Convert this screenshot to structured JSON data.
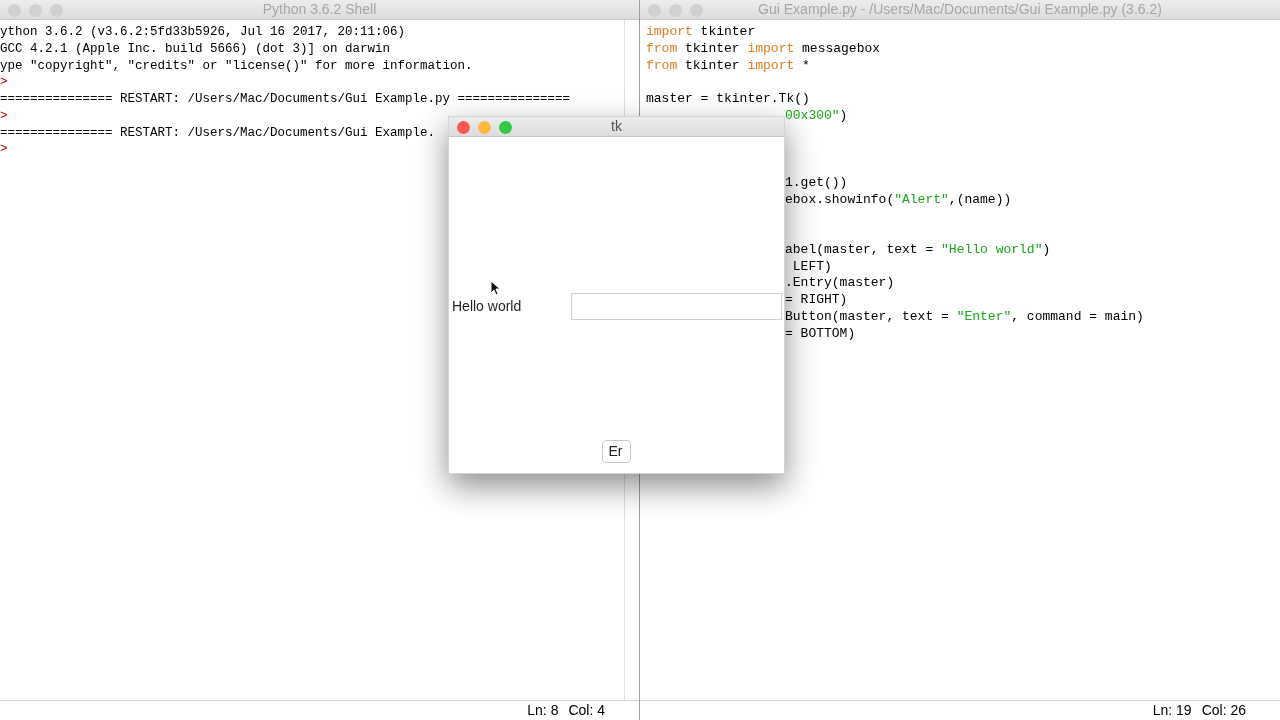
{
  "shell": {
    "title": "Python 3.6.2 Shell",
    "lines": [
      {
        "kind": "output",
        "text": "ython 3.6.2 (v3.6.2:5fd33b5926, Jul 16 2017, 20:11:06)"
      },
      {
        "kind": "output",
        "text": "GCC 4.2.1 (Apple Inc. build 5666) (dot 3)] on darwin"
      },
      {
        "kind": "output",
        "text": "ype \"copyright\", \"credits\" or \"license()\" for more information."
      },
      {
        "kind": "prompt",
        "text": ">"
      },
      {
        "kind": "output",
        "text": "=============== RESTART: /Users/Mac/Documents/Gui Example.py ==============="
      },
      {
        "kind": "prompt",
        "text": ">"
      },
      {
        "kind": "output",
        "text": "=============== RESTART: /Users/Mac/Documents/Gui Example."
      },
      {
        "kind": "prompt",
        "text": ">"
      }
    ],
    "status": {
      "line": "Ln: 8",
      "col": "Col: 4"
    }
  },
  "editor": {
    "title": "Gui Example.py - /Users/Mac/Documents/Gui Example.py (3.6.2)",
    "lines": [
      {
        "kind": "full",
        "segments": [
          {
            "kind": "keyword",
            "text": "import"
          },
          {
            "kind": "plain",
            "text": " tkinter"
          }
        ]
      },
      {
        "kind": "full",
        "segments": [
          {
            "kind": "keyword",
            "text": "from"
          },
          {
            "kind": "plain",
            "text": " tkinter "
          },
          {
            "kind": "keyword",
            "text": "import"
          },
          {
            "kind": "plain",
            "text": " messagebox"
          }
        ]
      },
      {
        "kind": "full",
        "segments": [
          {
            "kind": "keyword",
            "text": "from"
          },
          {
            "kind": "plain",
            "text": " tkinter "
          },
          {
            "kind": "keyword",
            "text": "import"
          },
          {
            "kind": "plain",
            "text": " *"
          }
        ]
      },
      {
        "kind": "blank"
      },
      {
        "kind": "full",
        "segments": [
          {
            "kind": "plain",
            "text": "master = tkinter.Tk()"
          }
        ]
      },
      {
        "kind": "partial",
        "segments": [
          {
            "kind": "string",
            "text": "00x300\""
          },
          {
            "kind": "plain",
            "text": ")"
          }
        ]
      },
      {
        "kind": "blank"
      },
      {
        "kind": "blank"
      },
      {
        "kind": "blank"
      },
      {
        "kind": "partial",
        "segments": [
          {
            "kind": "plain",
            "text": "1.get())"
          }
        ]
      },
      {
        "kind": "partial",
        "segments": [
          {
            "kind": "plain",
            "text": "ebox.showinfo("
          },
          {
            "kind": "string",
            "text": "\"Alert\""
          },
          {
            "kind": "plain",
            "text": ",(name))"
          }
        ]
      },
      {
        "kind": "blank"
      },
      {
        "kind": "blank"
      },
      {
        "kind": "partial",
        "segments": [
          {
            "kind": "plain",
            "text": "abel(master, text = "
          },
          {
            "kind": "string",
            "text": "\"Hello world\""
          },
          {
            "kind": "plain",
            "text": ")"
          }
        ]
      },
      {
        "kind": "partial",
        "segments": [
          {
            "kind": "plain",
            "text": " LEFT)"
          }
        ]
      },
      {
        "kind": "partial",
        "segments": [
          {
            "kind": "plain",
            "text": ".Entry(master)"
          }
        ]
      },
      {
        "kind": "partial",
        "segments": [
          {
            "kind": "plain",
            "text": "= RIGHT)"
          }
        ]
      },
      {
        "kind": "partial",
        "segments": [
          {
            "kind": "plain",
            "text": "Button(master, text = "
          },
          {
            "kind": "string",
            "text": "\"Enter\""
          },
          {
            "kind": "plain",
            "text": ", command = main)"
          }
        ]
      },
      {
        "kind": "partial",
        "segments": [
          {
            "kind": "plain",
            "text": "= BOTTOM)"
          }
        ]
      }
    ],
    "status": {
      "line": "Ln: 19",
      "col": "Col: 26"
    }
  },
  "tk": {
    "title": "tk",
    "label": "Hello world",
    "button": "Er"
  }
}
